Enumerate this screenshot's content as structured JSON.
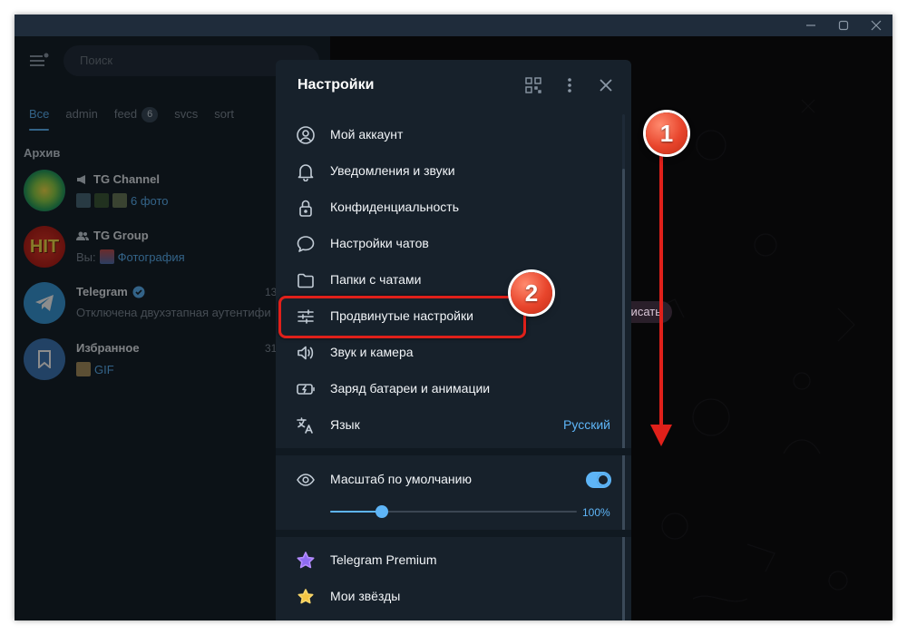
{
  "colors": {
    "accent": "#5eb5f7",
    "annotation_red": "#e0201a"
  },
  "window": {
    "controls": [
      "minimize-icon",
      "maximize-icon",
      "close-icon"
    ]
  },
  "sidebar": {
    "search_placeholder": "Поиск",
    "tabs": [
      {
        "label": "Все",
        "active": true
      },
      {
        "label": "admin"
      },
      {
        "label": "feed",
        "badge": "6"
      },
      {
        "label": "svcs"
      },
      {
        "label": "sort"
      }
    ],
    "archive_label": "Архив",
    "chats": [
      {
        "name": "TG Channel",
        "sub_link": "6 фото",
        "icon": "megaphone-icon"
      },
      {
        "name": "TG Group",
        "sub_prefix": "Вы:",
        "sub_link": "Фотография",
        "icon": "group-icon"
      },
      {
        "name": "Telegram",
        "time": "13",
        "sub": "Отключена двухэтапная аутентифи",
        "verified": true
      },
      {
        "name": "Избранное",
        "time": "31",
        "sub_link": "GIF"
      }
    ]
  },
  "chat_area": {
    "empty_hint": "...и бы написать"
  },
  "settings": {
    "title": "Настройки",
    "header_icons": [
      "qr-code-icon",
      "more-vertical-icon",
      "close-icon"
    ],
    "items": [
      {
        "label": "Мой аккаунт",
        "icon": "account-icon"
      },
      {
        "label": "Уведомления и звуки",
        "icon": "bell-icon"
      },
      {
        "label": "Конфиденциальность",
        "icon": "lock-icon"
      },
      {
        "label": "Настройки чатов",
        "icon": "chat-bubble-icon"
      },
      {
        "label": "Папки с чатами",
        "icon": "folder-icon"
      },
      {
        "label": "Продвинутые настройки",
        "icon": "sliders-icon"
      },
      {
        "label": "Звук и камера",
        "icon": "speaker-icon"
      },
      {
        "label": "Заряд батареи и анимации",
        "icon": "battery-icon"
      },
      {
        "label": "Язык",
        "value": "Русский",
        "icon": "translate-icon"
      }
    ],
    "scale": {
      "label": "Масштаб по умолчанию",
      "enabled": true,
      "value_label": "100%",
      "slider_fraction": 0.21
    },
    "premium_items": [
      {
        "label": "Telegram Premium",
        "icon": "premium-star-icon"
      },
      {
        "label": "Мои звёзды",
        "icon": "stars-icon"
      }
    ]
  },
  "annotations": {
    "step1": "1",
    "step2": "2"
  }
}
